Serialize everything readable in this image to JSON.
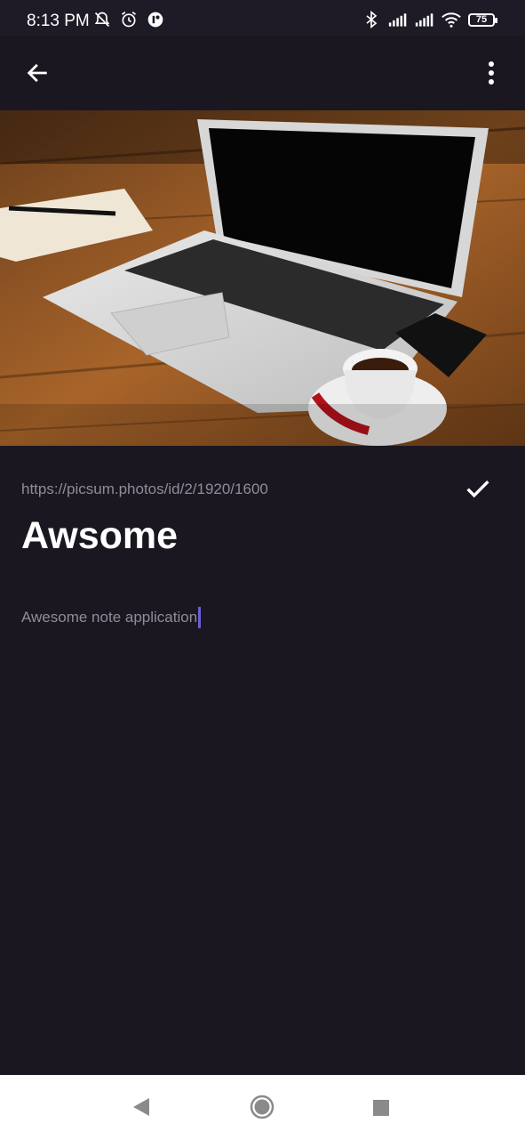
{
  "status_bar": {
    "time": "8:13 PM",
    "battery": "75",
    "left_icons": [
      "mute-icon",
      "alarm-icon",
      "app-notification-icon"
    ],
    "right_icons": [
      "bluetooth-icon",
      "signal-icon",
      "signal-icon",
      "wifi-icon",
      "battery-icon"
    ]
  },
  "app_bar": {
    "back_icon": "arrow-back-icon",
    "more_icon": "more-vertical-icon"
  },
  "note": {
    "image_url": "https://picsum.photos/id/2/1920/1600",
    "title": "Awsome",
    "body": "Awesome note application"
  },
  "nav_bar": {
    "icons": [
      "nav-back-icon",
      "nav-home-icon",
      "nav-recents-icon"
    ]
  },
  "colors": {
    "background": "#1a1721",
    "accent_caret": "#6b5ed2",
    "muted_text": "#8f8c98"
  }
}
